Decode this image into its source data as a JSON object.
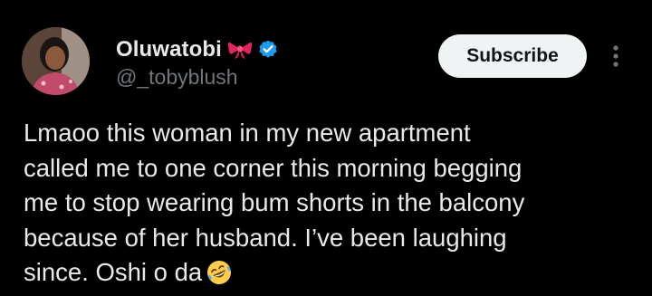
{
  "post": {
    "author": {
      "display_name": "Oluwatobi",
      "handle": "@_tobyblush",
      "name_emoji": "ribbon-bow-icon",
      "verified": true,
      "verified_color": "#1d9bf0"
    },
    "actions": {
      "subscribe_label": "Subscribe",
      "more_icon": "more-vertical-icon"
    },
    "text_lines": [
      "Lmaoo this woman in my new apartment",
      "called me to one corner this morning begging",
      "me to stop wearing bum shorts in the balcony",
      "because of her husband. I’ve been laughing",
      "since. Oshi o da"
    ],
    "text_end_emoji": "rolling-on-floor-laughing-icon"
  },
  "colors": {
    "background": "#000000",
    "text_primary": "#e7e9ea",
    "text_secondary": "#71767b",
    "button_bg": "#eff3f4",
    "button_text": "#0f1419"
  }
}
